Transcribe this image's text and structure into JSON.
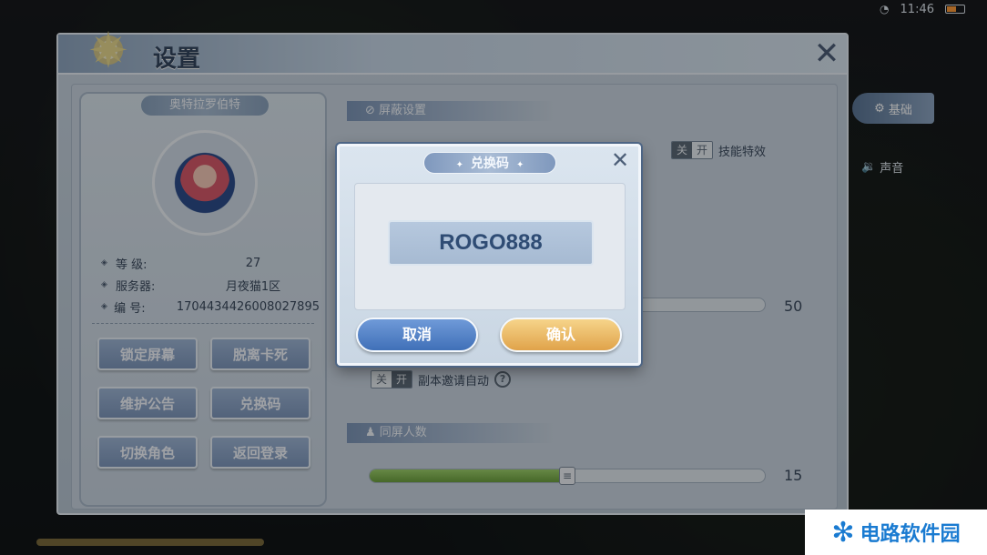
{
  "status": {
    "time": "11:46"
  },
  "settings": {
    "title": "设置",
    "profile": {
      "name": "奥特拉罗伯特",
      "stats": [
        {
          "label": "等 级:",
          "value": "27"
        },
        {
          "label": "服务器:",
          "value": "月夜猫1区"
        },
        {
          "label": "编 号:",
          "value": "1704434426008027895"
        }
      ],
      "buttons": [
        "锁定屏幕",
        "脱离卡死",
        "维护公告",
        "兑换码",
        "切换角色",
        "返回登录"
      ]
    },
    "shield_section": {
      "title": "屏蔽设置"
    },
    "skill_effect": {
      "off": "关",
      "on": "开",
      "label": "技能特效"
    },
    "slider1": {
      "value": "50",
      "fraction": 0.0
    },
    "dungeon_invite": {
      "off": "关",
      "on": "开",
      "label": "副本邀请自动",
      "help": "?"
    },
    "same_screen": {
      "title": "同屏人数",
      "value": "15",
      "fraction": 0.5,
      "knob": "≡"
    },
    "tabs": {
      "basic": "基础",
      "sound": "声音"
    }
  },
  "modal": {
    "title": "兑换码",
    "code": "ROGO888",
    "cancel": "取消",
    "confirm": "确认"
  },
  "watermark": {
    "text": "电路软件园"
  },
  "colors": {
    "accent": "#7f98bd",
    "confirm": "#e0a34a",
    "cancel": "#4070b8",
    "slider": "#6da03f"
  }
}
